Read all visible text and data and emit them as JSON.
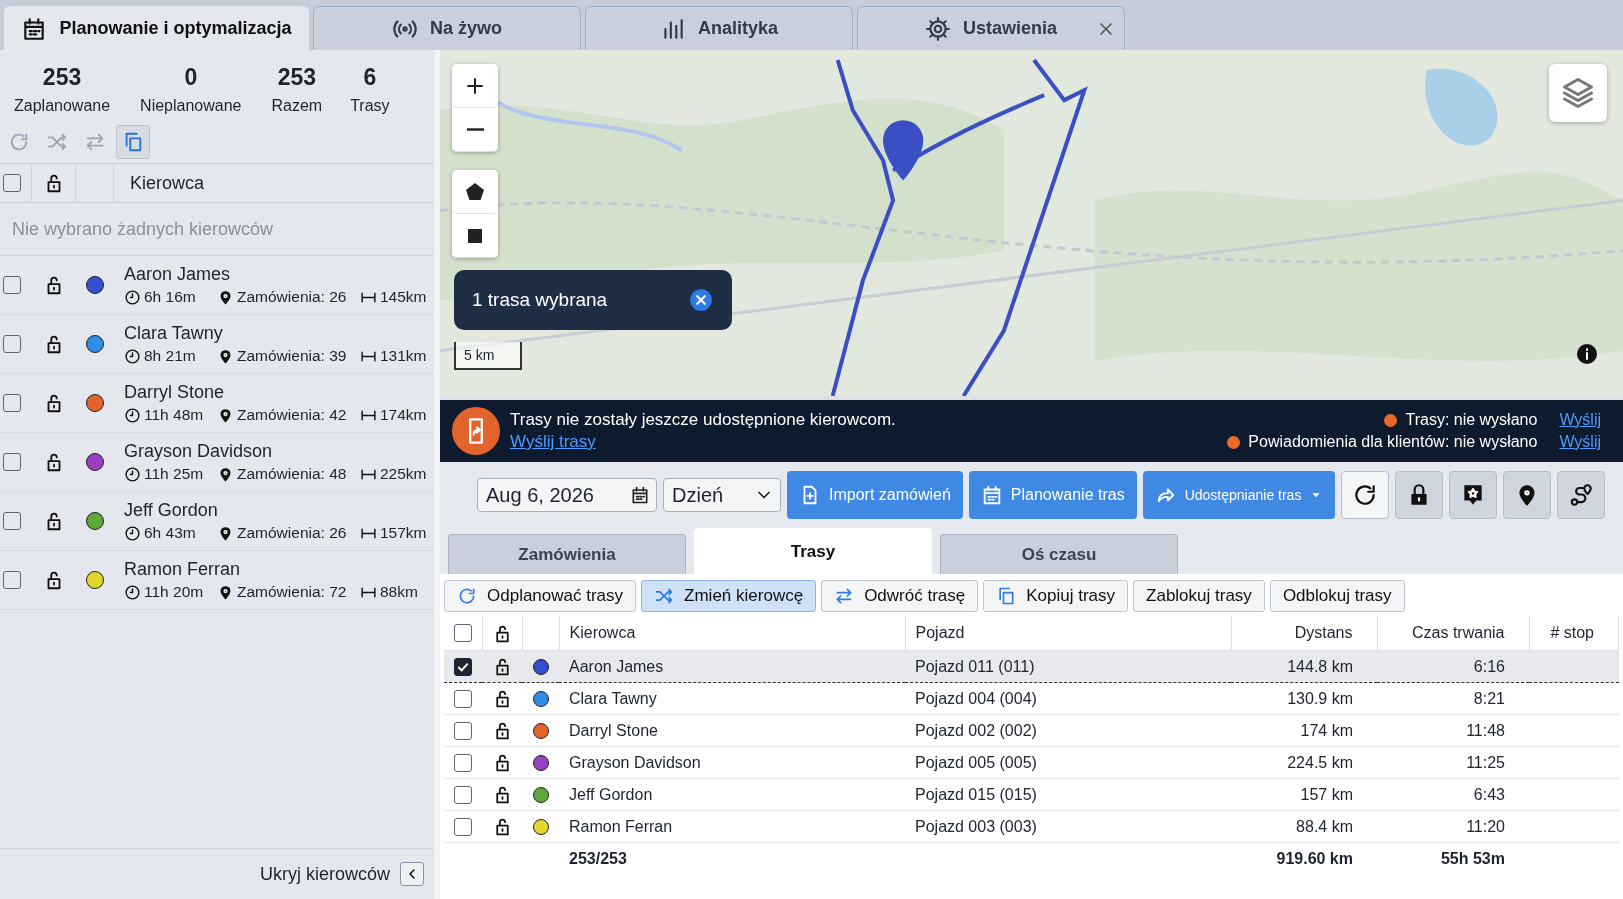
{
  "tabs": [
    {
      "label": "Planowanie i optymalizacja",
      "kind": "calendar",
      "selected": true,
      "closable": false
    },
    {
      "label": "Na żywo",
      "kind": "broadcast",
      "selected": false,
      "closable": false
    },
    {
      "label": "Analityka",
      "kind": "bars",
      "selected": false,
      "closable": false
    },
    {
      "label": "Ustawienia",
      "kind": "gear",
      "selected": false,
      "closable": true
    }
  ],
  "summary": [
    {
      "value": "253",
      "label": "Zaplanowane"
    },
    {
      "value": "0",
      "label": "Nieplanowane"
    },
    {
      "value": "253",
      "label": "Razem"
    },
    {
      "value": "6",
      "label": "Trasy"
    }
  ],
  "left_toolbar": [
    {
      "kind": "refresh",
      "selected": false
    },
    {
      "kind": "shuffle",
      "selected": false
    },
    {
      "kind": "swap",
      "selected": false
    },
    {
      "kind": "copy",
      "selected": true
    }
  ],
  "driver_list": {
    "header": "Kierowca",
    "all_checked": false,
    "empty_message": "Nie wybrano żadnych kierowców",
    "drivers": [
      {
        "name": "Aaron James",
        "color": "#3450d0",
        "checked": false,
        "locked": false,
        "duration": "6h 16m",
        "orders": "Zamówienia: 26",
        "distance": "145km"
      },
      {
        "name": "Clara Tawny",
        "color": "#2f8fe8",
        "checked": false,
        "locked": false,
        "duration": "8h 21m",
        "orders": "Zamówienia: 39",
        "distance": "131km"
      },
      {
        "name": "Darryl Stone",
        "color": "#e2642a",
        "checked": false,
        "locked": false,
        "duration": "11h 48m",
        "orders": "Zamówienia: 42",
        "distance": "174km"
      },
      {
        "name": "Grayson Davidson",
        "color": "#9a3fbf",
        "checked": false,
        "locked": false,
        "duration": "11h 25m",
        "orders": "Zamówienia: 48",
        "distance": "225km"
      },
      {
        "name": "Jeff Gordon",
        "color": "#5fa83a",
        "checked": false,
        "locked": false,
        "duration": "6h 43m",
        "orders": "Zamówienia: 26",
        "distance": "157km"
      },
      {
        "name": "Ramon Ferran",
        "color": "#e3d62c",
        "checked": false,
        "locked": false,
        "duration": "11h 20m",
        "orders": "Zamówienia: 72",
        "distance": "88km"
      }
    ]
  },
  "hide_drivers": "Ukryj kierowców",
  "map": {
    "selection": "1 trasa wybrana",
    "scale": "5 km"
  },
  "banner": {
    "message": "Trasy nie zostały jeszcze udostępnione kierowcom.",
    "link": "Wyślij trasy",
    "statuses": [
      {
        "label": "Trasy: nie wysłano",
        "action": "Wyślij"
      },
      {
        "label": "Powiadomienia dla klientów: nie wysłano",
        "action": "Wyślij"
      }
    ]
  },
  "toolbar": {
    "date": "Aug 6, 2026",
    "view": "Dzień",
    "buttons": [
      {
        "label": "Import zamówień",
        "kind": "file-plus",
        "dropdown": false
      },
      {
        "label": "Planowanie tras",
        "kind": "calendar",
        "dropdown": false
      },
      {
        "label": "Udostępnianie tras",
        "kind": "share",
        "dropdown": true
      }
    ],
    "icon_buttons": [
      {
        "kind": "refresh"
      },
      {
        "kind": "lock"
      },
      {
        "kind": "star-message"
      },
      {
        "kind": "pin"
      },
      {
        "kind": "route"
      }
    ]
  },
  "subtabs": [
    {
      "label": "Zamówienia",
      "selected": false
    },
    {
      "label": "Trasy",
      "selected": true
    },
    {
      "label": "Oś czasu",
      "selected": false
    }
  ],
  "actions": [
    {
      "label": "Odplanować trasy",
      "kind": "refresh",
      "selected": false
    },
    {
      "label": "Zmień kierowcę",
      "kind": "shuffle",
      "selected": true
    },
    {
      "label": "Odwróć trasę",
      "kind": "swap",
      "selected": false
    },
    {
      "label": "Kopiuj trasy",
      "kind": "copy",
      "selected": false
    },
    {
      "label": "Zablokuj trasy",
      "selected": false
    },
    {
      "label": "Odblokuj trasy",
      "selected": false
    }
  ],
  "table": {
    "all_checked": false,
    "columns": [
      "Kierowca",
      "Pojazd",
      "Dystans",
      "Czas trwania",
      "# stop"
    ],
    "rows": [
      {
        "selected": true,
        "checked": true,
        "locked": false,
        "color": "#3450d0",
        "driver": "Aaron James",
        "vehicle": "Pojazd 011 (011)",
        "distance": "144.8 km",
        "duration": "6:16"
      },
      {
        "selected": false,
        "checked": false,
        "locked": false,
        "color": "#2f8fe8",
        "driver": "Clara Tawny",
        "vehicle": "Pojazd 004 (004)",
        "distance": "130.9 km",
        "duration": "8:21"
      },
      {
        "selected": false,
        "checked": false,
        "locked": false,
        "color": "#e2642a",
        "driver": "Darryl Stone",
        "vehicle": "Pojazd 002 (002)",
        "distance": "174 km",
        "duration": "11:48"
      },
      {
        "selected": false,
        "checked": false,
        "locked": false,
        "color": "#9a3fbf",
        "driver": "Grayson Davidson",
        "vehicle": "Pojazd 005 (005)",
        "distance": "224.5 km",
        "duration": "11:25"
      },
      {
        "selected": false,
        "checked": false,
        "locked": false,
        "color": "#5fa83a",
        "driver": "Jeff Gordon",
        "vehicle": "Pojazd 015 (015)",
        "distance": "157 km",
        "duration": "6:43"
      },
      {
        "selected": false,
        "checked": false,
        "locked": false,
        "color": "#e3d62c",
        "driver": "Ramon Ferran",
        "vehicle": "Pojazd 003 (003)",
        "distance": "88.4 km",
        "duration": "11:20"
      }
    ],
    "totals": {
      "orders": "253/253",
      "distance": "919.60 km",
      "duration": "55h 53m"
    }
  }
}
